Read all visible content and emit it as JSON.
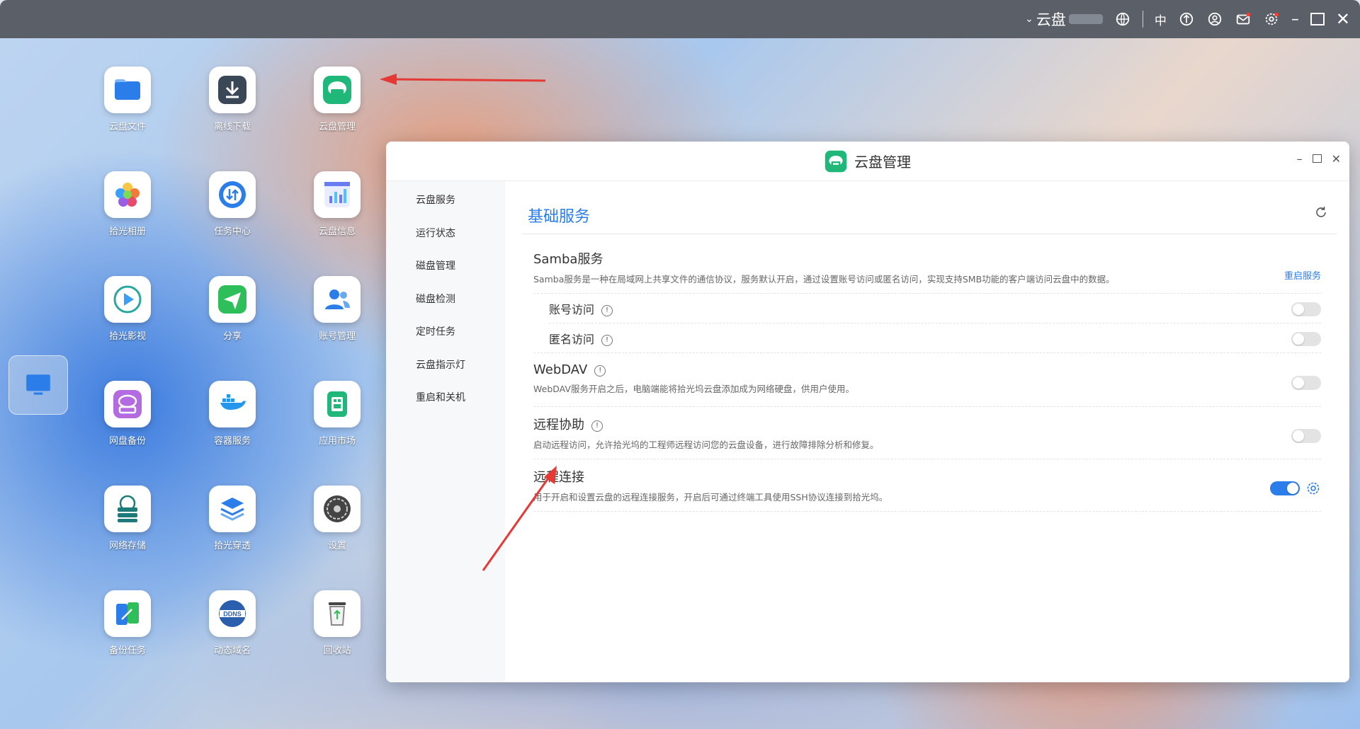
{
  "topbar": {
    "cloud_menu": "云盘",
    "ime_label": "中",
    "controls": [
      "minimize",
      "maximize",
      "close"
    ]
  },
  "apps": [
    {
      "label": "云盘文件",
      "icon": "folder-icon",
      "color": "#2b7de9"
    },
    {
      "label": "离线下载",
      "icon": "download-icon",
      "color": "#3a4756"
    },
    {
      "label": "云盘管理",
      "icon": "cloud-drive-icon",
      "color": "#1fb87a"
    },
    {
      "label": "拾光相册",
      "icon": "photos-icon",
      "color": "#f27b3b"
    },
    {
      "label": "任务中心",
      "icon": "task-center-icon",
      "color": "#2b7de9"
    },
    {
      "label": "云盘信息",
      "icon": "chart-icon",
      "color": "#6a7df0"
    },
    {
      "label": "拾光影视",
      "icon": "video-play-icon",
      "color": "#2aa8a0"
    },
    {
      "label": "分享",
      "icon": "send-icon",
      "color": "#2fbf5a"
    },
    {
      "label": "账号管理",
      "icon": "users-icon",
      "color": "#2b7de9"
    },
    {
      "label": "网盘备份",
      "icon": "cloud-backup-icon",
      "color": "#b46ae0"
    },
    {
      "label": "容器服务",
      "icon": "docker-icon",
      "color": "#2496ed"
    },
    {
      "label": "应用市场",
      "icon": "app-market-icon",
      "color": "#1fb87a"
    },
    {
      "label": "网络存储",
      "icon": "network-storage-icon",
      "color": "#1e7a7a"
    },
    {
      "label": "拾光穿透",
      "icon": "layers-icon",
      "color": "#2b7de9"
    },
    {
      "label": "设置",
      "icon": "settings-icon",
      "color": "#444"
    },
    {
      "label": "备份任务",
      "icon": "backup-task-icon",
      "color": "#2b7de9"
    },
    {
      "label": "动态域名",
      "icon": "ddns-icon",
      "color": "#2b5fae"
    },
    {
      "label": "回收站",
      "icon": "recycle-bin-icon",
      "color": "#888"
    }
  ],
  "window": {
    "title": "云盘管理",
    "sidebar": [
      "云盘服务",
      "运行状态",
      "磁盘管理",
      "磁盘检测",
      "定时任务",
      "云盘指示灯",
      "重启和关机"
    ],
    "section_title": "基础服务",
    "samba": {
      "title": "Samba服务",
      "desc": "Samba服务是一种在局域网上共享文件的通信协议，服务默认开启，通过设置账号访问或匿名访问，实现支持SMB功能的客户端访问云盘中的数据。",
      "restart_link": "重启服务",
      "account_access": {
        "label": "账号访问",
        "enabled": false
      },
      "anonymous_access": {
        "label": "匿名访问",
        "enabled": false
      }
    },
    "webdav": {
      "title": "WebDAV",
      "desc": "WebDAV服务开启之后，电脑端能将拾光坞云盘添加成为网络硬盘，供用户使用。",
      "enabled": false
    },
    "remote_assist": {
      "title": "远程协助",
      "desc": "启动远程访问，允许拾光坞的工程师远程访问您的云盘设备，进行故障排除分析和修复。",
      "enabled": false
    },
    "remote_connect": {
      "title": "远程连接",
      "desc": "用于开启和设置云盘的远程连接服务，开启后可通过终端工具使用SSH协议连接到拾光坞。",
      "enabled": true
    }
  },
  "colors": {
    "accent": "#2b7de9",
    "annotation_arrow": "#e53935"
  }
}
